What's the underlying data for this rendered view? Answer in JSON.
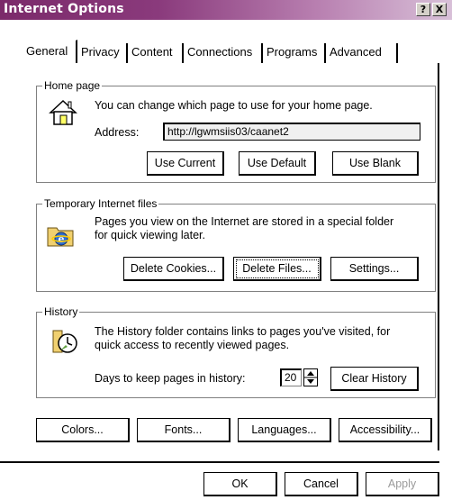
{
  "window": {
    "title": "Internet Options",
    "help_btn": "?",
    "close_btn": "X"
  },
  "tabs": [
    {
      "label": "General",
      "active": true
    },
    {
      "label": "Privacy",
      "active": false
    },
    {
      "label": "Content",
      "active": false
    },
    {
      "label": "Connections",
      "active": false
    },
    {
      "label": "Programs",
      "active": false
    },
    {
      "label": "Advanced",
      "active": false
    }
  ],
  "home_page": {
    "group_title": "Home page",
    "description": "You can change which page to use for your home page.",
    "address_label": "Address:",
    "address_value": "http://lgwmsiis03/caanet2",
    "buttons": {
      "use_current": "Use Current",
      "use_default": "Use Default",
      "use_blank": "Use Blank"
    },
    "icon": "house-icon"
  },
  "temp_files": {
    "group_title": "Temporary Internet files",
    "description_line1": "Pages you view on the Internet are stored in a special folder",
    "description_line2": "for quick viewing later.",
    "buttons": {
      "delete_cookies": "Delete Cookies...",
      "delete_files": "Delete Files...",
      "settings": "Settings..."
    },
    "icon": "ie-folder-icon"
  },
  "history": {
    "group_title": "History",
    "description_line1": "The History folder contains links to pages you've visited, for",
    "description_line2": "quick access to recently viewed pages.",
    "days_label": "Days to keep pages in history:",
    "days_value": "20",
    "clear_button": "Clear History",
    "icon": "history-clock-icon"
  },
  "bottom_buttons": {
    "colors": "Colors...",
    "fonts": "Fonts...",
    "languages": "Languages...",
    "accessibility": "Accessibility..."
  },
  "dialog_buttons": {
    "ok": "OK",
    "cancel": "Cancel",
    "apply": "Apply"
  }
}
